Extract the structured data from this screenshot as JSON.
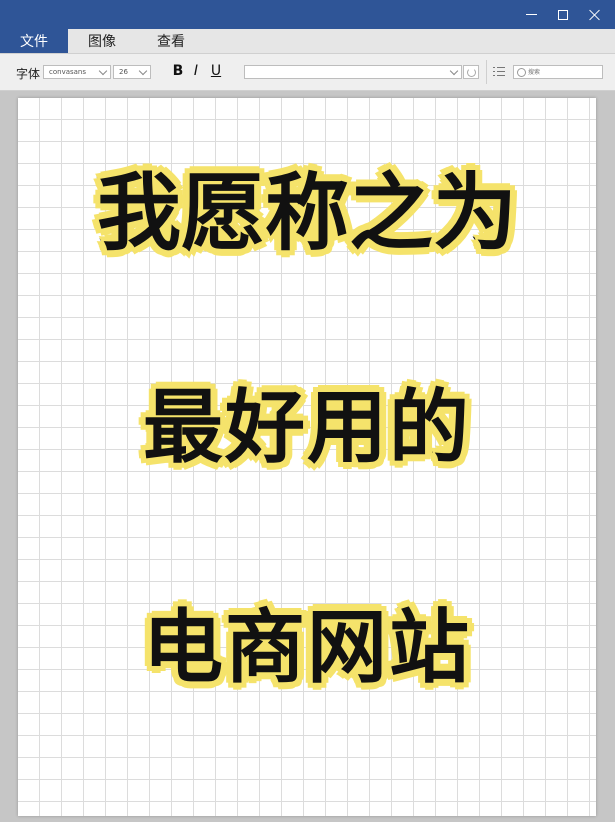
{
  "window": {
    "controls": {
      "minimize": "minimize",
      "maximize": "maximize",
      "close": "close"
    }
  },
  "menu": {
    "items": [
      {
        "label": "文件",
        "active": true
      },
      {
        "label": "图像",
        "active": false
      },
      {
        "label": "查看",
        "active": false
      }
    ]
  },
  "toolbar": {
    "font_label": "字体",
    "font_value": "convasans",
    "size_value": "26",
    "bold": "B",
    "italic": "I",
    "underline": "U",
    "style_value": "",
    "search_placeholder": "搜索"
  },
  "canvas": {
    "lines": [
      "我愿称之为",
      "最好用的",
      "电商网站"
    ],
    "text_color": "#111111",
    "outline_color": "#f5e36b",
    "background": "#ffffff",
    "grid_color": "#dcdcdc"
  },
  "colors": {
    "titlebar": "#2f5597",
    "menubar": "#e6e6e6",
    "workspace": "#c6c6c6"
  }
}
